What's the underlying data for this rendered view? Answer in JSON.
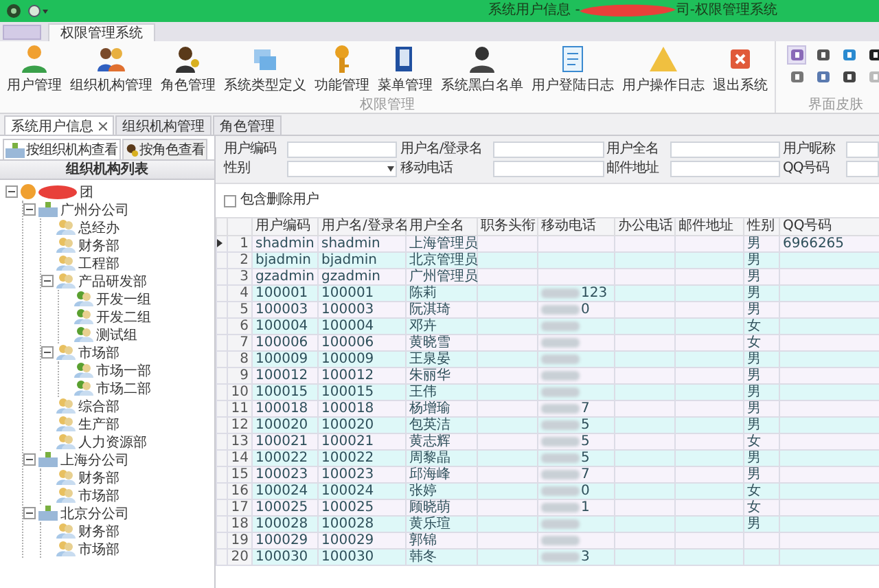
{
  "window": {
    "title_start": "系统用户信息 - ",
    "title_end": "司-权限管理系统"
  },
  "ribbon": {
    "tabs": [
      {
        "label": "权限管理系统",
        "selected": true
      }
    ],
    "groups": [
      {
        "label": "权限管理",
        "buttons": [
          {
            "kind": "user",
            "label": "用户管理"
          },
          {
            "kind": "org",
            "label": "组织机构管理"
          },
          {
            "kind": "role",
            "label": "角色管理"
          },
          {
            "kind": "types",
            "label": "系统类型定义"
          },
          {
            "kind": "key",
            "label": "功能管理"
          },
          {
            "kind": "menu",
            "label": "菜单管理"
          },
          {
            "kind": "person",
            "label": "系统黑白名单"
          },
          {
            "kind": "log",
            "label": "用户登陆日志"
          },
          {
            "kind": "warning",
            "label": "用户操作日志"
          },
          {
            "kind": "exit",
            "label": "退出系统"
          }
        ]
      }
    ],
    "skin_group": {
      "label": "界面皮肤",
      "skins": [
        {
          "selected": true
        },
        {
          "selected": false
        },
        {
          "selected": false
        },
        {
          "selected": false
        },
        {
          "selected": false
        },
        {
          "selected": false
        },
        {
          "selected": false
        },
        {
          "selected": false
        }
      ]
    }
  },
  "doc_tabs": [
    {
      "label": "系统用户信息",
      "selected": true
    },
    {
      "label": "组织机构管理",
      "selected": false
    },
    {
      "label": "角色管理",
      "selected": false
    }
  ],
  "left_panel": {
    "tabs": [
      {
        "label": "按组织机构查看",
        "selected": true
      },
      {
        "label": "按角色查看",
        "selected": false
      }
    ],
    "header": "组织机构列表",
    "tree": [
      {
        "label": "团",
        "expanded": true,
        "children": [
          {
            "label": "广州分公司",
            "expanded": true,
            "children": [
              {
                "label": "总经办"
              },
              {
                "label": "财务部"
              },
              {
                "label": "工程部"
              },
              {
                "label": "产品研发部",
                "expanded": true,
                "children": [
                  {
                    "label": "开发一组"
                  },
                  {
                    "label": "开发二组"
                  },
                  {
                    "label": "测试组"
                  }
                ]
              },
              {
                "label": "市场部",
                "expanded": true,
                "children": [
                  {
                    "label": "市场一部"
                  },
                  {
                    "label": "市场二部"
                  }
                ]
              },
              {
                "label": "综合部"
              },
              {
                "label": "生产部"
              },
              {
                "label": "人力资源部"
              }
            ]
          },
          {
            "label": "上海分公司",
            "expanded": true,
            "children": [
              {
                "label": "财务部"
              },
              {
                "label": "市场部"
              }
            ]
          },
          {
            "label": "北京分公司",
            "expanded": true,
            "children": [
              {
                "label": "财务部"
              },
              {
                "label": "市场部"
              }
            ]
          }
        ]
      }
    ]
  },
  "filters": [
    {
      "label": "用户编码",
      "kind": "text"
    },
    {
      "label": "用户名/登录名",
      "kind": "text"
    },
    {
      "label": "用户全名",
      "kind": "text"
    },
    {
      "label": "用户昵称",
      "kind": "text"
    },
    {
      "label": "性别",
      "kind": "select"
    },
    {
      "label": "移动电话",
      "kind": "text"
    },
    {
      "label": "邮件地址",
      "kind": "text"
    },
    {
      "label": "QQ号码",
      "kind": "text"
    }
  ],
  "include_deleted": {
    "label": "包含删除用户",
    "checked": false
  },
  "table": {
    "columns": [
      "用户编码",
      "用户名/登录名",
      "用户全名",
      "职务头衔",
      "移动电话",
      "办公电话",
      "邮件地址",
      "性别",
      "QQ号码"
    ],
    "rows": [
      {
        "num": "1",
        "code": "shadmin",
        "login": "shadmin",
        "name": "上海管理员",
        "phone_masked": false,
        "sex": "男",
        "qq": "6966265",
        "selected": true
      },
      {
        "num": "2",
        "code": "bjadmin",
        "login": "bjadmin",
        "name": "北京管理员",
        "phone_masked": false,
        "sex": "男",
        "selected": false
      },
      {
        "num": "3",
        "code": "gzadmin",
        "login": "gzadmin",
        "name": "广州管理员",
        "phone_masked": false,
        "sex": "男",
        "selected": false
      },
      {
        "num": "4",
        "code": "100001",
        "login": "100001",
        "name": "陈莉",
        "phone_masked": true,
        "phone": "123",
        "sex": "男",
        "selected": false
      },
      {
        "num": "5",
        "code": "100003",
        "login": "100003",
        "name": "阮淇琦",
        "phone_masked": true,
        "phone": "0",
        "sex": "男",
        "selected": false
      },
      {
        "num": "6",
        "code": "100004",
        "login": "100004",
        "name": "邓卉",
        "phone_masked": true,
        "sex": "女",
        "selected": false
      },
      {
        "num": "7",
        "code": "100006",
        "login": "100006",
        "name": "黄晓雪",
        "phone_masked": true,
        "sex": "女",
        "selected": false
      },
      {
        "num": "8",
        "code": "100009",
        "login": "100009",
        "name": "王泉晏",
        "phone_masked": true,
        "sex": "男",
        "selected": false
      },
      {
        "num": "9",
        "code": "100012",
        "login": "100012",
        "name": "朱丽华",
        "phone_masked": true,
        "sex": "男",
        "selected": false
      },
      {
        "num": "10",
        "code": "100015",
        "login": "100015",
        "name": "王伟",
        "phone_masked": true,
        "sex": "男",
        "selected": false
      },
      {
        "num": "11",
        "code": "100018",
        "login": "100018",
        "name": "杨增瑜",
        "phone_masked": true,
        "phone": "7",
        "sex": "男",
        "selected": false
      },
      {
        "num": "12",
        "code": "100020",
        "login": "100020",
        "name": "包英洁",
        "phone_masked": true,
        "phone": "5",
        "sex": "男",
        "selected": false
      },
      {
        "num": "13",
        "code": "100021",
        "login": "100021",
        "name": "黄志辉",
        "phone_masked": true,
        "phone": "5",
        "sex": "女",
        "selected": false
      },
      {
        "num": "14",
        "code": "100022",
        "login": "100022",
        "name": "周黎晶",
        "phone_masked": true,
        "phone": "5",
        "sex": "男",
        "selected": false
      },
      {
        "num": "15",
        "code": "100023",
        "login": "100023",
        "name": "邱海峰",
        "phone_masked": true,
        "phone": "7",
        "sex": "男",
        "selected": false
      },
      {
        "num": "16",
        "code": "100024",
        "login": "100024",
        "name": "张婷",
        "phone_masked": true,
        "phone": "0",
        "sex": "女",
        "selected": false
      },
      {
        "num": "17",
        "code": "100025",
        "login": "100025",
        "name": "顾晓萌",
        "phone_masked": true,
        "phone": "1",
        "sex": "女",
        "selected": false
      },
      {
        "num": "18",
        "code": "100028",
        "login": "100028",
        "name": "黄乐瑄",
        "phone_masked": true,
        "sex": "男",
        "selected": false
      },
      {
        "num": "19",
        "code": "100029",
        "login": "100029",
        "name": "郭锦",
        "phone_masked": true,
        "selected": false
      },
      {
        "num": "20",
        "code": "100030",
        "login": "100030",
        "name": "韩冬",
        "phone_masked": true,
        "phone": "3",
        "selected": false
      }
    ]
  }
}
